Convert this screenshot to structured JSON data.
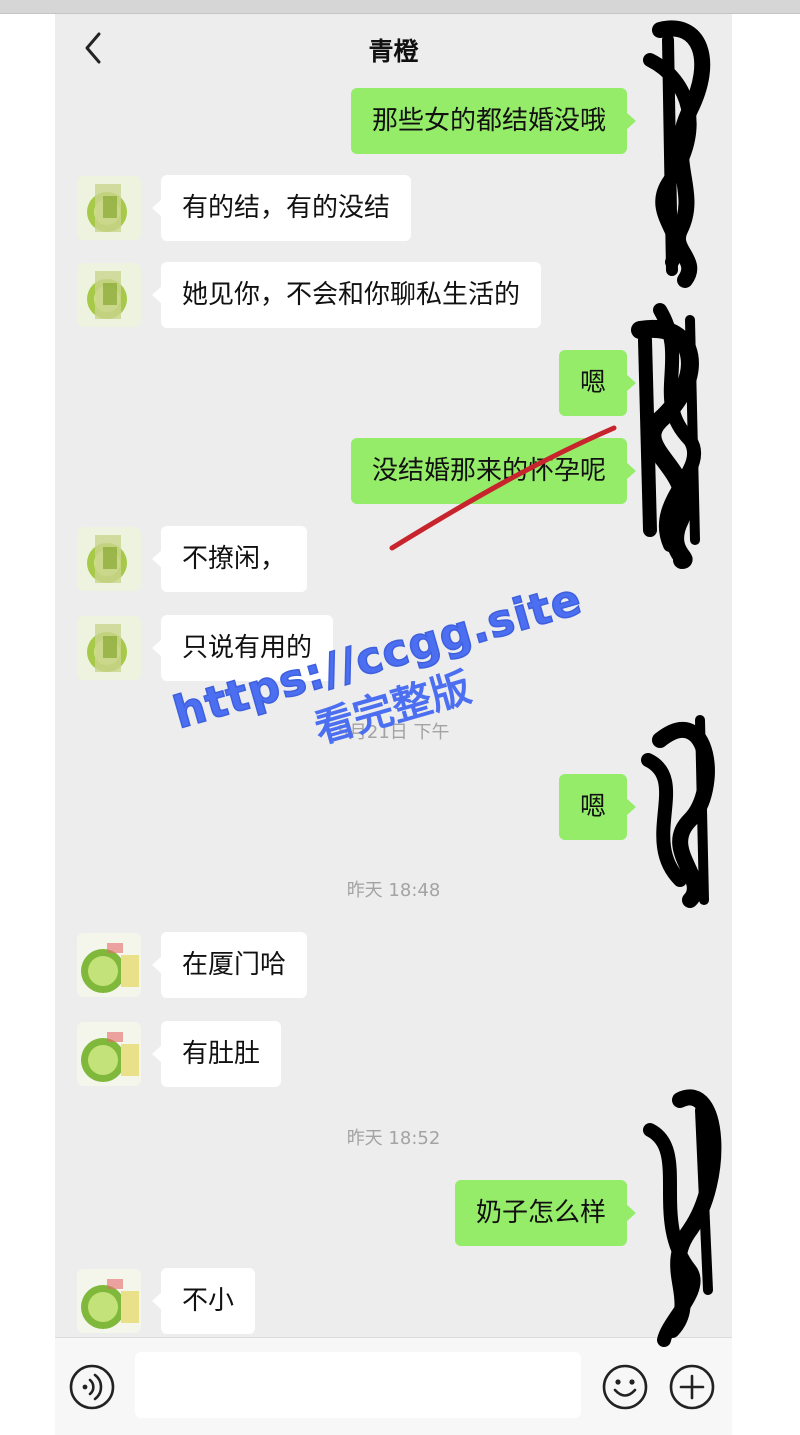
{
  "header": {
    "title": "青橙"
  },
  "messages": [
    {
      "side": "out",
      "text": "那些女的都结婚没哦"
    },
    {
      "side": "in",
      "text": "有的结，有的没结"
    },
    {
      "side": "in",
      "text": "她见你，不会和你聊私生活的"
    },
    {
      "side": "out",
      "text": "嗯"
    },
    {
      "side": "out",
      "text": "没结婚那来的怀孕呢"
    },
    {
      "side": "in",
      "text": "不撩闲，"
    },
    {
      "side": "in",
      "text": "只说有用的"
    },
    {
      "side": "time",
      "text": "5月21日 下午"
    },
    {
      "side": "out",
      "text": "嗯"
    },
    {
      "side": "time",
      "text": "昨天 18:48"
    },
    {
      "side": "in",
      "text": "在厦门哈"
    },
    {
      "side": "in",
      "text": "有肚肚"
    },
    {
      "side": "time",
      "text": "昨天 18:52"
    },
    {
      "side": "out",
      "text": "奶子怎么样"
    },
    {
      "side": "in",
      "text": "不小"
    }
  ],
  "input_bar": {
    "icons": [
      "voice-icon",
      "emoji-icon",
      "plus-icon"
    ]
  },
  "watermark": {
    "url": "https://ccgg.site",
    "text": "看完整版"
  },
  "colors": {
    "chat_background": "#ededed",
    "outgoing_bubble": "#95ec69",
    "incoming_bubble": "#ffffff",
    "watermark": "#4b6ff0",
    "strike_line": "#c8242d",
    "redaction": "#000000"
  }
}
